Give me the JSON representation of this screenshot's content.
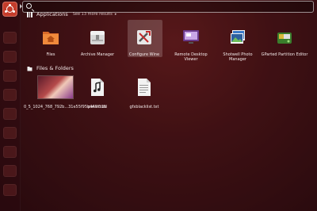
{
  "search": {
    "placeholder": "",
    "value": ""
  },
  "applications": {
    "title": "Applications",
    "more_results": "See 13 more results",
    "items": [
      {
        "label": "Files",
        "icon": "folder-home-icon"
      },
      {
        "label": "Archive Manager",
        "icon": "archive-manager-icon"
      },
      {
        "label": "Configure Wine",
        "icon": "wine-config-icon"
      },
      {
        "label": "Remote Desktop Viewer",
        "icon": "remote-desktop-icon"
      },
      {
        "label": "Shotwell Photo Manager",
        "icon": "shotwell-icon"
      },
      {
        "label": "GParted Partition Editor",
        "icon": "gparted-icon"
      }
    ]
  },
  "files_folders": {
    "title": "Files & Folders",
    "items": [
      {
        "label": "0_5_1024_768_792b...31e55f95b449f135",
        "icon": "image-thumbnail-icon"
      },
      {
        "label": "pata.mod",
        "icon": "audio-file-icon"
      },
      {
        "label": "gfxblacklist.txt",
        "icon": "text-file-icon"
      }
    ]
  },
  "colors": {
    "accent": "#c43c2b",
    "background": "#4a1518"
  }
}
